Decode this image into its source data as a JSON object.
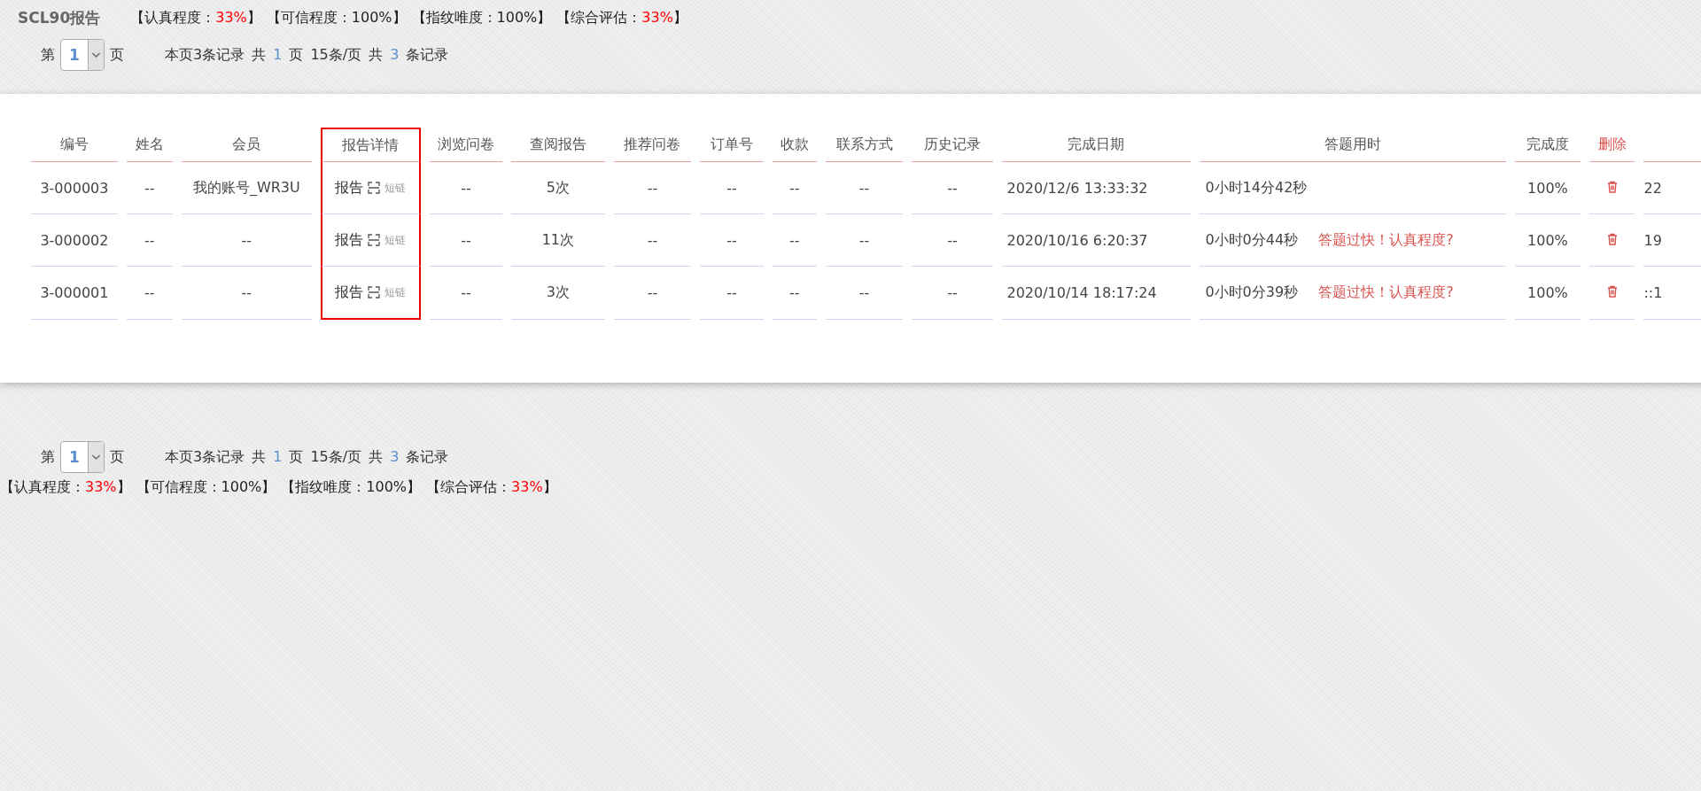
{
  "header": {
    "title": "SCL90报告",
    "stats": [
      {
        "label": "【认真程度：",
        "value": "33%",
        "close": "】",
        "alert": true
      },
      {
        "label": "【可信程度：",
        "value": "100%",
        "close": "】",
        "alert": false
      },
      {
        "label": "【指纹唯度：",
        "value": "100%",
        "close": "】",
        "alert": false
      },
      {
        "label": "【综合评估：",
        "value": "33%",
        "close": "】",
        "alert": true
      }
    ]
  },
  "pager_top": {
    "prefix": "第",
    "page": "1",
    "suffix": "页",
    "parts": [
      {
        "text": "本页3条记录",
        "accent": false
      },
      {
        "text": "共",
        "accent": false
      },
      {
        "text": "1",
        "accent": true
      },
      {
        "text": "页",
        "accent": false
      },
      {
        "text": "15条/页",
        "accent": false
      },
      {
        "text": "共",
        "accent": false
      },
      {
        "text": "3",
        "accent": true
      },
      {
        "text": "条记录",
        "accent": false
      }
    ]
  },
  "table": {
    "columns": [
      {
        "label": "编号",
        "kind": "normal",
        "highlighted": false
      },
      {
        "label": "姓名",
        "kind": "normal",
        "highlighted": false
      },
      {
        "label": "会员",
        "kind": "normal",
        "highlighted": false
      },
      {
        "label": "报告详情",
        "kind": "normal",
        "highlighted": true
      },
      {
        "label": "浏览问卷",
        "kind": "normal",
        "highlighted": false
      },
      {
        "label": "查阅报告",
        "kind": "normal",
        "highlighted": false
      },
      {
        "label": "推荐问卷",
        "kind": "normal",
        "highlighted": false
      },
      {
        "label": "订单号",
        "kind": "normal",
        "highlighted": false
      },
      {
        "label": "收款",
        "kind": "normal",
        "highlighted": false
      },
      {
        "label": "联系方式",
        "kind": "normal",
        "highlighted": false
      },
      {
        "label": "历史记录",
        "kind": "normal",
        "highlighted": false
      },
      {
        "label": "完成日期",
        "kind": "normal",
        "highlighted": false
      },
      {
        "label": "答题用时",
        "kind": "normal",
        "highlighted": false
      },
      {
        "label": "完成度",
        "kind": "normal",
        "highlighted": false
      },
      {
        "label": "删除",
        "kind": "danger",
        "highlighted": false
      },
      {
        "kind": "normal",
        "highlighted": false
      }
    ],
    "rows": [
      {
        "id": "3-000003",
        "name": "--",
        "member": "我的账号_WR3U",
        "report": "报告",
        "short_link": "短链",
        "browse": "--",
        "views": "5次",
        "recommend": "--",
        "order": "--",
        "payment": "--",
        "contact": "--",
        "history": "--",
        "completed": "2020/12/6 13:33:32",
        "duration": "0小时14分42秒",
        "completion": "100%",
        "column_16": "22"
      },
      {
        "id": "3-000002",
        "name": "--",
        "member": "--",
        "report": "报告",
        "short_link": "短链",
        "browse": "--",
        "views": "11次",
        "recommend": "--",
        "order": "--",
        "payment": "--",
        "contact": "--",
        "history": "--",
        "completed": "2020/10/16 6:20:37",
        "duration": "0小时0分44秒",
        "warning": "答题过快！认真程度?",
        "completion": "100%",
        "column_16": "19"
      },
      {
        "id": "3-000001",
        "name": "--",
        "member": "--",
        "report": "报告",
        "short_link": "短链",
        "browse": "--",
        "views": "3次",
        "recommend": "--",
        "order": "--",
        "payment": "--",
        "contact": "--",
        "history": "--",
        "completed": "2020/10/14 18:17:24",
        "duration": "0小时0分39秒",
        "warning": "答题过快！认真程度?",
        "completion": "100%",
        "column_16": "::1"
      }
    ]
  },
  "pager_bottom": {
    "prefix": "第",
    "page": "1",
    "suffix": "页",
    "parts": [
      {
        "text": "本页3条记录",
        "accent": false
      },
      {
        "text": "共",
        "accent": false
      },
      {
        "text": "1",
        "accent": true
      },
      {
        "text": "页",
        "accent": false
      },
      {
        "text": "15条/页",
        "accent": false
      },
      {
        "text": "共",
        "accent": false
      },
      {
        "text": "3",
        "accent": true
      },
      {
        "text": "条记录",
        "accent": false
      }
    ]
  },
  "footer_stats": [
    {
      "label": "【认真程度：",
      "value": "33%",
      "close": "】",
      "alert": true
    },
    {
      "label": "【可信程度：",
      "value": "100%",
      "close": "】",
      "alert": false
    },
    {
      "label": "【指纹唯度：",
      "value": "100%",
      "close": "】",
      "alert": false
    },
    {
      "label": "【综合评估：",
      "value": "33%",
      "close": "】",
      "alert": true
    }
  ]
}
